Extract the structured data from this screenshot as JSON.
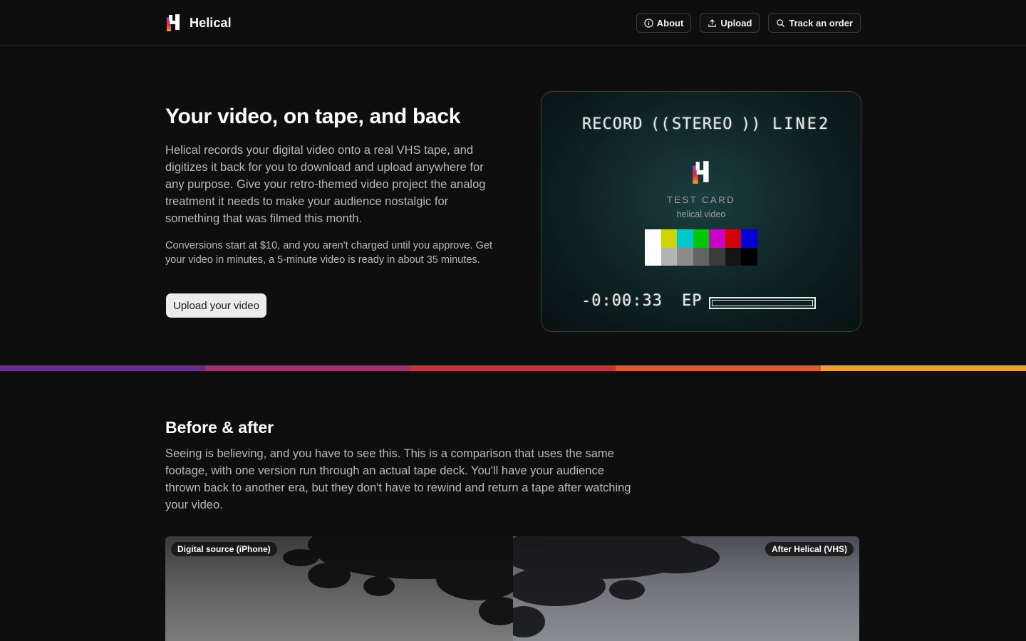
{
  "header": {
    "brand": "Helical",
    "nav": {
      "about": "About",
      "upload": "Upload",
      "track": "Track an order"
    }
  },
  "hero": {
    "title": "Your video, on tape, and back",
    "description": "Helical records your digital video onto a real VHS tape, and digitizes it back for you to download and upload anywhere for any purpose. Give your retro-themed video project the analog treatment it needs to make your audience nostalgic for something that was filmed this month.",
    "note": "Conversions start at $10, and you aren't charged until you approve. Get your video in minutes, a 5-minute video is ready in about 35 minutes.",
    "cta": "Upload your video"
  },
  "test_card": {
    "record": "RECORD",
    "wave_left": "((",
    "stereo": "STEREO",
    "wave_right": "))",
    "line": "LINE2",
    "label": "TEST CARD",
    "url": "helical.video",
    "time": "-0:00:33",
    "speed": "EP",
    "tape_remaining": 0.02,
    "bars_top": [
      "#ffffff",
      "#d2d200",
      "#00c8c8",
      "#00c800",
      "#c800c8",
      "#d20000",
      "#0000d2"
    ],
    "bars_bottom": [
      "#ffffff",
      "#b4b4b4",
      "#8c8c8c",
      "#646464",
      "#3c3c3c",
      "#141414",
      "#000000"
    ]
  },
  "before_after": {
    "title": "Before & after",
    "description": "Seeing is believing, and you have to see this. This is a comparison that uses the same footage, with one version run through an actual tape deck. You'll have your audience thrown back to another era, but they don't have to rewind and return a tape after watching your video.",
    "left_label": "Digital source (iPhone)",
    "right_label": "After Helical (VHS)"
  },
  "colors": {
    "background": "#0f0e0f",
    "strip": [
      "#6a2c8f",
      "#a0306e",
      "#c8323a",
      "#e0592a",
      "#f0a02a"
    ]
  }
}
